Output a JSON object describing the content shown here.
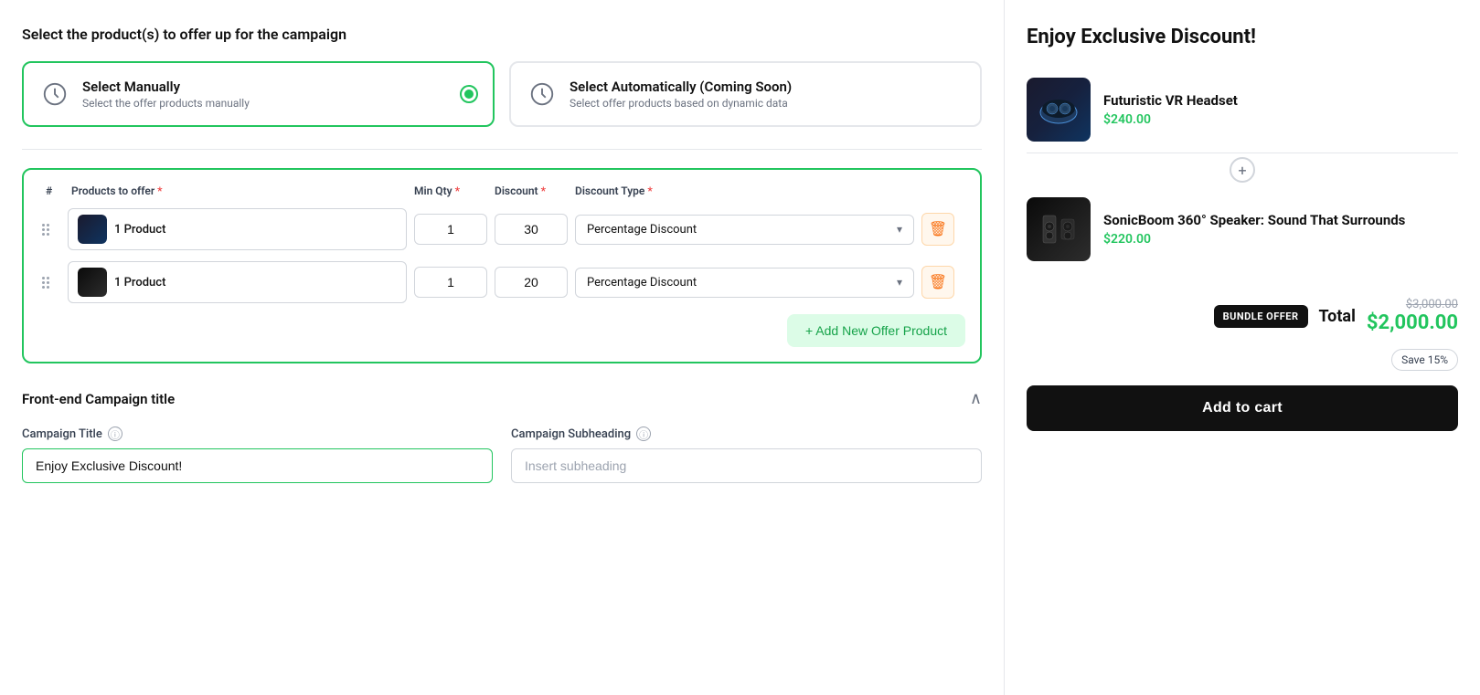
{
  "left": {
    "main_title": "Select the product(s) to offer up for the campaign",
    "selection_cards": [
      {
        "id": "manual",
        "title": "Select Manually",
        "subtitle": "Select the offer products manually",
        "active": true
      },
      {
        "id": "automatic",
        "title": "Select Automatically (Coming Soon)",
        "subtitle": "Select offer products based on dynamic data",
        "active": false
      }
    ],
    "table": {
      "headers": {
        "hash": "#",
        "products": "Products to offer",
        "min_qty": "Min Qty",
        "discount": "Discount",
        "discount_type": "Discount Type"
      },
      "rows": [
        {
          "product_name": "1 Product",
          "min_qty": "1",
          "discount": "30",
          "discount_type": "Percentage Discount"
        },
        {
          "product_name": "1 Product",
          "min_qty": "1",
          "discount": "20",
          "discount_type": "Percentage Discount"
        }
      ],
      "add_btn_label": "+ Add New Offer Product"
    },
    "campaign_section": {
      "title": "Front-end Campaign title",
      "campaign_title_label": "Campaign Title",
      "campaign_title_value": "Enjoy Exclusive Discount!",
      "campaign_title_placeholder": "Enjoy Exclusive Discount!",
      "subheading_label": "Campaign Subheading",
      "subheading_placeholder": "Insert subheading"
    }
  },
  "right": {
    "preview_title": "Enjoy Exclusive Discount!",
    "products": [
      {
        "name": "Futuristic VR Headset",
        "price": "$240.00",
        "type": "vr"
      },
      {
        "name": "SonicBoom 360° Speaker: Sound That Surrounds",
        "price": "$220.00",
        "type": "speaker"
      }
    ],
    "bundle_badge": "BUNDLE OFFER",
    "total_label": "Total",
    "original_price": "$3,000.00",
    "discounted_price": "$2,000.00",
    "save_label": "Save 15%",
    "add_to_cart": "Add to cart"
  }
}
